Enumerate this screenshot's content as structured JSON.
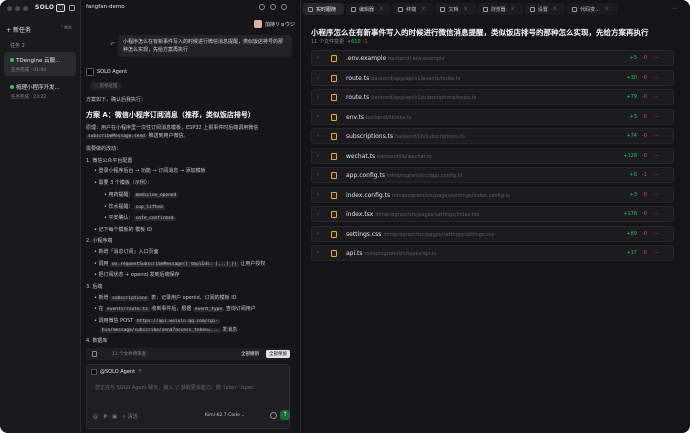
{
  "sidebar": {
    "logo": "SOLO",
    "new_task": "新任务",
    "new_task_shortcut": "⌃⌘N",
    "tasks_header": "任务  2",
    "tasks": [
      {
        "title": "TDengine 云服...",
        "time": "任务完成 · 01:04"
      },
      {
        "title": "梳理小程序开发...",
        "time": "任务完成 · 23:22"
      }
    ]
  },
  "chat": {
    "project": "fangfan-demo",
    "user_name": "加持リョウジ",
    "user_message": "小程序怎么在有新事件写入的时候进行微信消息提醒，类似饭店排号的那种怎么实现，先给方案再执行",
    "agent_name": "SOLO Agent",
    "thinking_label": "思考过程",
    "intro": "方案如下，确认后我执行：",
    "plan_title": "方案 A：微信小程序订阅消息（推荐，类似饭店排号）",
    "principle_a": "原理：用户在小程序里一次性订阅消息模板，ESP32 上报事件时后端调用微信",
    "principle_code": "subscribeMessage.send",
    "principle_b": "推送到用户微信。",
    "changes_header": "需要做的改动：",
    "step1": "1. 微信公众平台配置",
    "step1_a": "登录小程序后台 → 功能 → 订阅消息 → 添加模板",
    "step1_b": "需要 3 个模板（示例）：",
    "templates": [
      {
        "label": "用药提醒：",
        "code": "medicine_opened"
      },
      {
        "label": "饮水提醒：",
        "code": "cup_lifted"
      },
      {
        "label": "平安确认：",
        "code": "safe_confirmed"
      }
    ],
    "step1_c": "记下每个模板的 模板 ID",
    "step2": "2. 小程序端",
    "step2_a": "新增「消息订阅」入口页面",
    "step2_b_pre": "调用",
    "step2_b_code": "wx.requestSubscribeMessage({ tmplIds: [...] })",
    "step2_b_post": "让用户授权",
    "step2_c": "把订阅状态 + openid 发到后端保存",
    "step3": "3. 后端",
    "step3_a_pre": "新增",
    "step3_a_code": "subscriptions",
    "step3_a_post": "表：记录用户 openid、订阅的模板 ID",
    "step3_b_pre": "在",
    "step3_b_code": "events/route.ts",
    "step3_b_mid": "收到事件后，根据",
    "step3_b_code2": "event_type",
    "step3_b_post": "查询订阅用户",
    "step3_c_pre": "调用微信 POST",
    "step3_c_code": "https://api.weixin.qq.com/cgi-",
    "step3_c_code2": "bin/message/subscribe/send?access_token=...",
    "step3_c_post": "发消息",
    "step4": "4. 数据库",
    "files_changed": "11 个文件待审查",
    "reject_all": "全部撤销",
    "accept_all": "全部保留",
    "mention": "@SOLO Agent",
    "placeholder": "您正在与 SOLO Agent 聊天，输入 '/' 获取更多能力，按 '/plan' '/spec'",
    "clear_label": "清洁",
    "model": "Kimi-K2.7-Code"
  },
  "panel": {
    "tabs": [
      {
        "label": "实时跟随",
        "active": true
      },
      {
        "label": "编辑器",
        "active": false
      },
      {
        "label": "终端",
        "active": false
      },
      {
        "label": "文档",
        "active": false
      },
      {
        "label": "浏览器",
        "active": false
      },
      {
        "label": "设置",
        "active": false
      },
      {
        "label": "代码变...",
        "active": false
      }
    ],
    "title": "小程序怎么在有新事件写入的时候进行微信消息提醒，类似饭店排号的那种怎么实现，先给方案再执行",
    "sub_count": "11 个文件变更",
    "sub_add": "+610",
    "sub_del": "-1",
    "files": [
      {
        "name": ".env.example",
        "path": "backend/.env.example",
        "add": "+5",
        "del": "-0"
      },
      {
        "name": "route.ts",
        "path": "backend/app/api/v1/events/route.ts",
        "add": "+30",
        "del": "-0"
      },
      {
        "name": "route.ts",
        "path": "backend/app/api/v1/subscriptions/route.ts",
        "add": "+79",
        "del": "-0"
      },
      {
        "name": "env.ts",
        "path": "backend/lib/env.ts",
        "add": "+5",
        "del": "-0"
      },
      {
        "name": "subscriptions.ts",
        "path": "backend/lib/subscriptions.ts",
        "add": "+74",
        "del": "-0"
      },
      {
        "name": "wechat.ts",
        "path": "backend/lib/wechat.ts",
        "add": "+128",
        "del": "-0"
      },
      {
        "name": "app.config.ts",
        "path": "miniprogram/src/app.config.ts",
        "add": "+6",
        "del": "-1"
      },
      {
        "name": "index.config.ts",
        "path": "miniprogram/src/pages/settings/index.config.ts",
        "add": "+3",
        "del": "-0"
      },
      {
        "name": "index.tsx",
        "path": "miniprogram/src/pages/settings/index.tsx",
        "add": "+176",
        "del": "-0"
      },
      {
        "name": "settings.css",
        "path": "miniprogram/src/pages/settings/settings.css",
        "add": "+89",
        "del": "-0"
      },
      {
        "name": "api.ts",
        "path": "miniprogram/src/types/api.ts",
        "add": "+17",
        "del": "-0"
      }
    ]
  }
}
